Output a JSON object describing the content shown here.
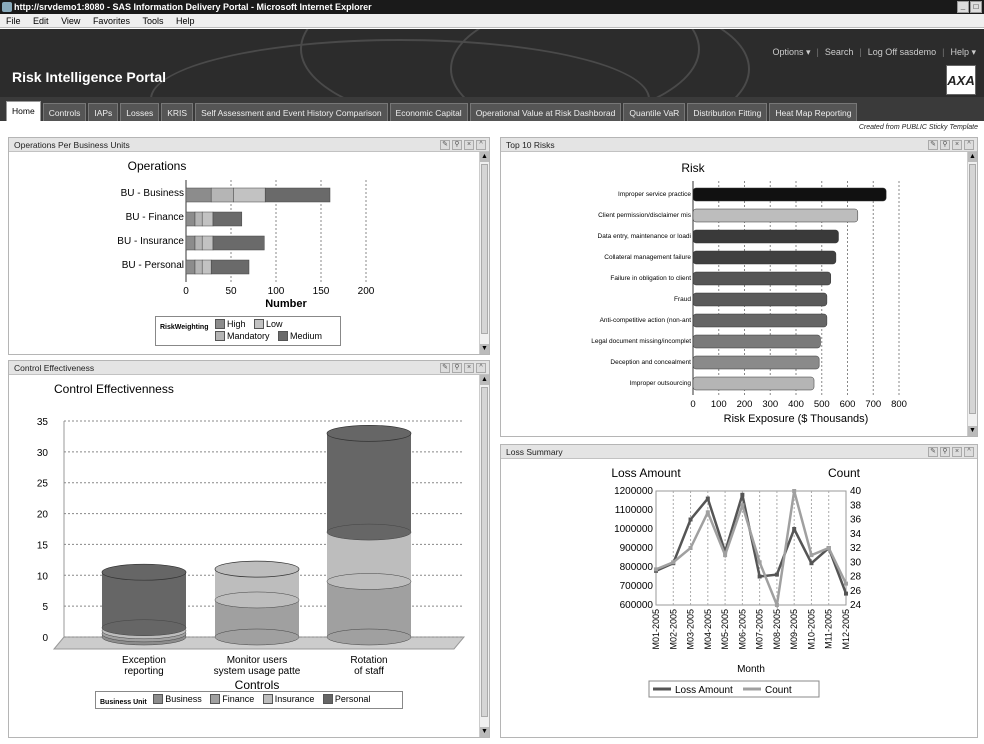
{
  "window": {
    "title": "http://srvdemo1:8080 - SAS Information Delivery Portal - Microsoft Internet Explorer"
  },
  "menu": [
    "File",
    "Edit",
    "View",
    "Favorites",
    "Tools",
    "Help"
  ],
  "portal": {
    "title": "Risk Intelligence Portal",
    "logo_text": "AXA",
    "links": [
      "Options ▾",
      "Search",
      "Log Off sasdemo",
      "Help ▾"
    ]
  },
  "tabs": [
    "Home",
    "Controls",
    "IAPs",
    "Losses",
    "KRIS",
    "Self Assessment and Event History Comparison",
    "Economic Capital",
    "Operational Value at Risk Dashborad",
    "Quantile VaR",
    "Distribution Fitting",
    "Heat Map Reporting"
  ],
  "created_note": "Created from PUBLIC Sticky Template",
  "panels": {
    "ops": "Operations Per Business Units",
    "top10": "Top 10 Risks",
    "control": "Control Effectiveness",
    "loss": "Loss Summary"
  },
  "colors": {
    "dark": "#3a3a3a",
    "mid": "#6f6f6f",
    "light": "#a9a9a9",
    "pale": "#c8c8c8",
    "line_dark": "#555555",
    "line_light": "#9a9a9a"
  },
  "chart_data": [
    {
      "type": "bar",
      "orientation": "horizontal-stacked",
      "title": "Operations",
      "xlabel": "Number",
      "categories": [
        "BU - Business",
        "BU - Finance",
        "BU - Insurance",
        "BU - Personal"
      ],
      "series": [
        {
          "name": "High",
          "values": [
            28,
            10,
            10,
            10
          ]
        },
        {
          "name": "Mandatory",
          "values": [
            25,
            8,
            8,
            8
          ]
        },
        {
          "name": "Low",
          "values": [
            35,
            12,
            12,
            10
          ]
        },
        {
          "name": "Medium",
          "values": [
            72,
            32,
            57,
            42
          ]
        }
      ],
      "xlim": [
        0,
        200
      ],
      "xticks": [
        "0",
        "50",
        "100",
        "150",
        "200"
      ],
      "legend_title": "RiskWeighting",
      "legend_labels": [
        "High",
        "Low",
        "Mandatory",
        "Medium"
      ]
    },
    {
      "type": "bar",
      "orientation": "horizontal",
      "title": "Risk",
      "xlabel": "Risk Exposure ($ Thousands)",
      "categories": [
        "Improper service practice",
        "Client permission/disclaimer mis",
        "Data entry, maintenance or loadi",
        "Collateral management failure",
        "Failure in obligation to client",
        "Fraud",
        "Anti-competitive action (non-ant",
        "Legal document missing/incomplet",
        "Deception and concealment",
        "Improper outsourcing"
      ],
      "values": [
        750,
        640,
        565,
        555,
        535,
        520,
        520,
        495,
        490,
        470
      ],
      "xlim": [
        0,
        800
      ],
      "xticks": [
        "0",
        "100",
        "200",
        "300",
        "400",
        "500",
        "600",
        "700",
        "800"
      ]
    },
    {
      "type": "bar",
      "orientation": "vertical-stacked-3d",
      "title": "Control Effectivenness",
      "xlabel": "Controls",
      "categories": [
        "Exception reporting",
        "Monitor users system usage patte",
        "Rotation of staff"
      ],
      "category_lines": [
        [
          "Exception",
          "reporting"
        ],
        [
          "Monitor users",
          "system usage patte"
        ],
        [
          "Rotation",
          "of staff"
        ]
      ],
      "series": [
        {
          "name": "Business",
          "values": [
            0.5,
            0,
            0
          ]
        },
        {
          "name": "Finance",
          "values": [
            0.5,
            6,
            9
          ]
        },
        {
          "name": "Insurance",
          "values": [
            0.5,
            5,
            8
          ]
        },
        {
          "name": "Personal",
          "values": [
            9,
            0,
            16
          ]
        }
      ],
      "ylim": [
        0,
        35
      ],
      "yticks": [
        "0",
        "5",
        "10",
        "15",
        "20",
        "25",
        "30",
        "35"
      ],
      "legend_title": "Business Unit",
      "legend_labels": [
        "Business",
        "Finance",
        "Insurance",
        "Personal"
      ]
    },
    {
      "type": "line",
      "title": "Loss Amount",
      "right_title": "Count",
      "xlabel": "Month",
      "x": [
        "M01-2005",
        "M02-2005",
        "M03-2005",
        "M04-2005",
        "M05-2005",
        "M06-2005",
        "M07-2005",
        "M08-2005",
        "M09-2005",
        "M10-2005",
        "M11-2005",
        "M12-2005"
      ],
      "series": [
        {
          "name": "Loss Amount",
          "axis": "left",
          "values": [
            780000,
            820000,
            1050000,
            1160000,
            880000,
            1180000,
            750000,
            760000,
            1000000,
            820000,
            900000,
            660000
          ]
        },
        {
          "name": "Count",
          "axis": "right",
          "values": [
            29,
            30,
            32,
            37,
            31,
            38,
            30,
            24,
            40,
            31,
            32,
            27
          ]
        }
      ],
      "ylim": [
        600000,
        1200000
      ],
      "yticks": [
        "600000",
        "700000",
        "800000",
        "900000",
        "1000000",
        "1100000",
        "1200000"
      ],
      "y2lim": [
        24,
        40
      ],
      "y2ticks": [
        "24",
        "26",
        "28",
        "30",
        "32",
        "34",
        "36",
        "38",
        "40"
      ]
    }
  ]
}
